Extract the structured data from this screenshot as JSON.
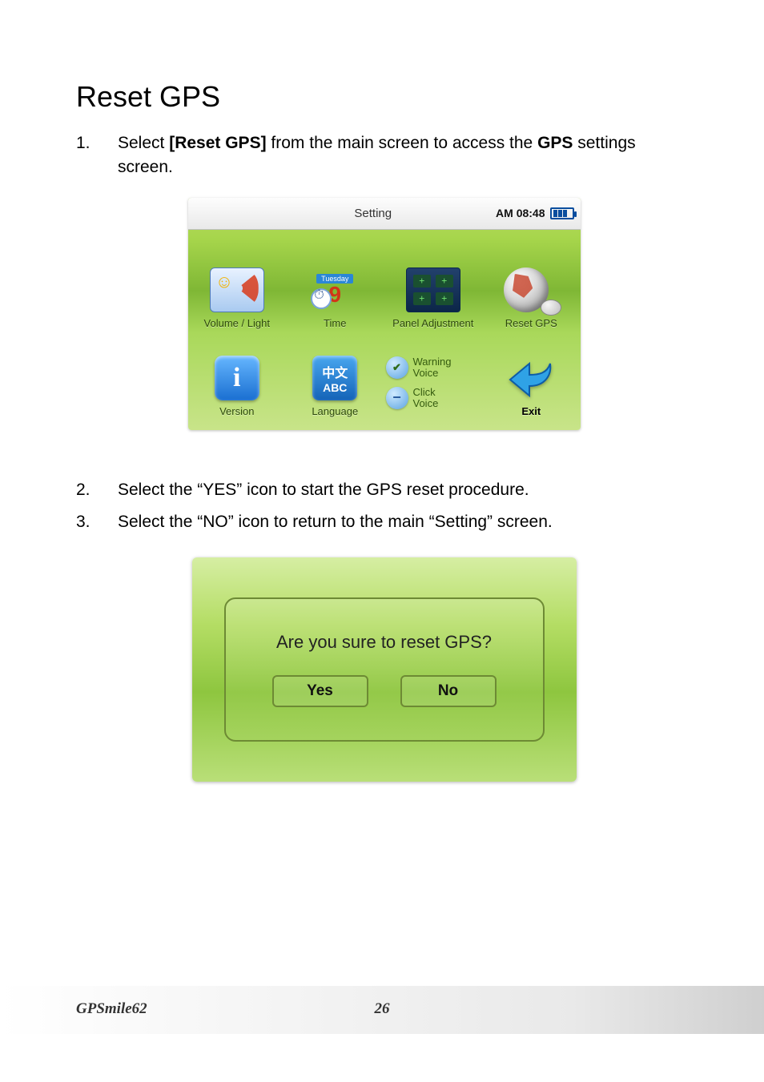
{
  "heading": "Reset GPS",
  "steps": [
    {
      "num": "1.",
      "pre": "Select ",
      "bold1": "[Reset GPS]",
      "mid": " from the main screen to access the ",
      "bold2": "GPS",
      "post": " settings screen."
    },
    {
      "num": "2.",
      "text": "Select the “YES” icon to start the GPS reset procedure."
    },
    {
      "num": "3.",
      "text": "Select the “NO” icon to return to the main “Setting” screen."
    }
  ],
  "screen1": {
    "title": "Setting",
    "clock": "AM 08:48",
    "tiles": {
      "volume_light": "Volume / Light",
      "time": {
        "label": "Time",
        "weekday": "Tuesday",
        "day": "9"
      },
      "panel": "Panel Adjustment",
      "reset_gps": "Reset GPS",
      "version": "Version",
      "language": {
        "label": "Language",
        "cjk": "中文",
        "abc": "ABC"
      },
      "warning_voice": "Warning\nVoice",
      "click_voice": "Click\nVoice",
      "exit": "Exit"
    }
  },
  "screen2": {
    "question": "Are you sure to reset GPS?",
    "yes": "Yes",
    "no": "No"
  },
  "footer": {
    "product": "GPSmile62",
    "page": "26"
  }
}
